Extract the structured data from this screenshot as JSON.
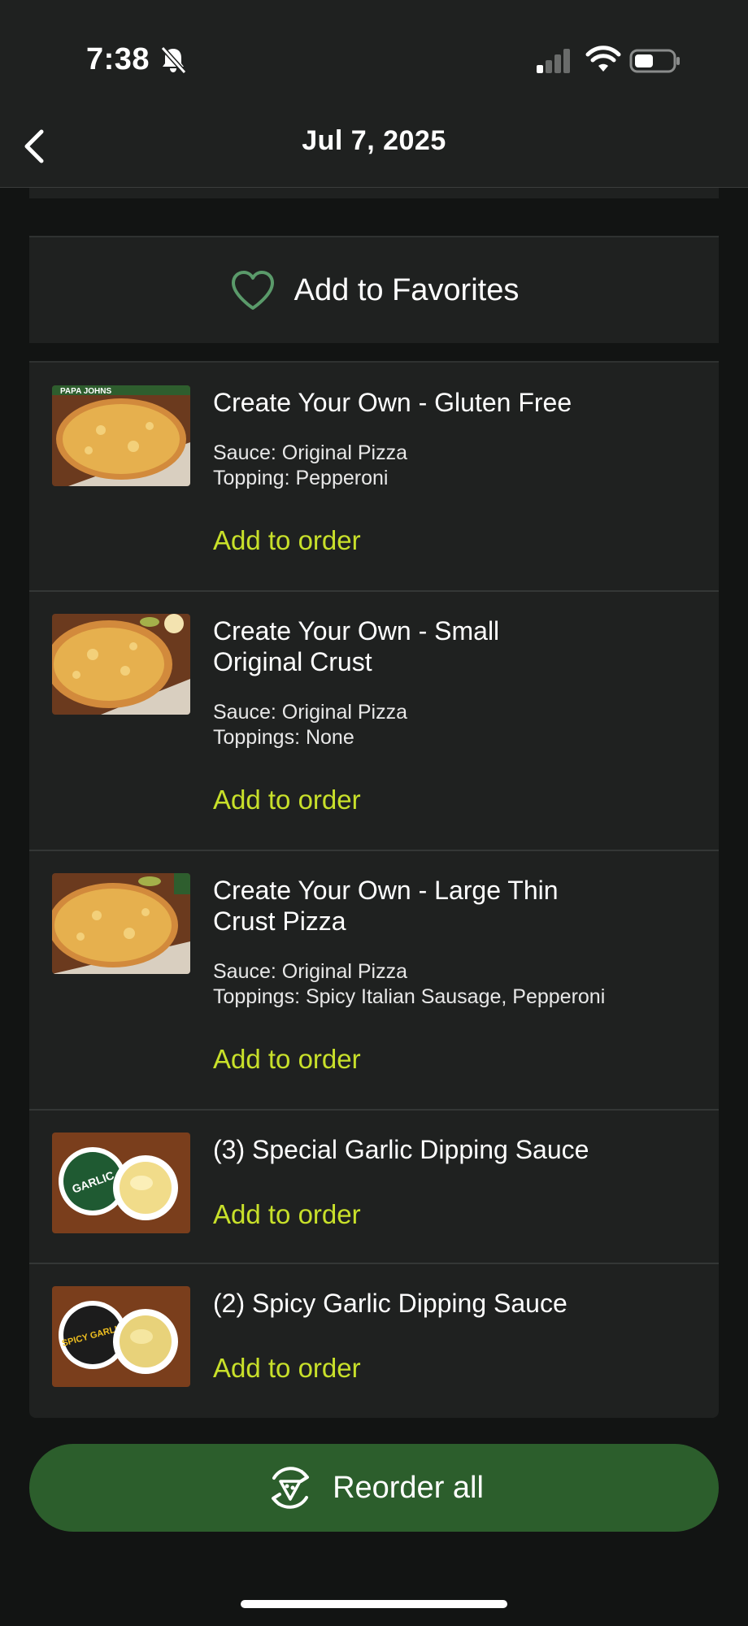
{
  "status_bar": {
    "time": "7:38",
    "icons": [
      "bell-slash-icon",
      "cellular-signal-icon",
      "wifi-icon",
      "battery-icon"
    ]
  },
  "header": {
    "back_icon": "chevron-left-icon",
    "title": "Jul 7, 2025"
  },
  "favorites": {
    "icon": "heart-outline-icon",
    "label": "Add to Favorites"
  },
  "items": [
    {
      "title": "Create Your Own - Gluten Free",
      "details": [
        "Sauce: Original Pizza",
        "Topping: Pepperoni"
      ],
      "action": "Add to order",
      "thumb": "cheese-pizza-image"
    },
    {
      "title": "Create Your Own - Small Original Crust",
      "details": [
        "Sauce: Original Pizza",
        "Toppings: None"
      ],
      "action": "Add to order",
      "thumb": "cheese-pizza-image"
    },
    {
      "title": "Create Your Own - Large Thin Crust Pizza",
      "details": [
        "Sauce: Original Pizza",
        "Toppings: Spicy Italian Sausage, Pepperoni"
      ],
      "action": "Add to order",
      "thumb": "cheese-pizza-image"
    },
    {
      "title": "(3) Special Garlic Dipping Sauce",
      "details": [],
      "action": "Add to order",
      "thumb": "garlic-sauce-image",
      "thumb_text": "GARLIC"
    },
    {
      "title": "(2) Spicy Garlic Dipping Sauce",
      "details": [],
      "action": "Add to order",
      "thumb": "spicy-garlic-sauce-image",
      "thumb_text": "SPICY GARLIC"
    }
  ],
  "reorder": {
    "icon": "reorder-pizza-icon",
    "label": "Reorder all"
  },
  "colors": {
    "background": "#121413",
    "card": "#1f2120",
    "accent_link": "#c8e02a",
    "button_green": "#2c5e2c",
    "heart_green": "#5a9a6a"
  }
}
